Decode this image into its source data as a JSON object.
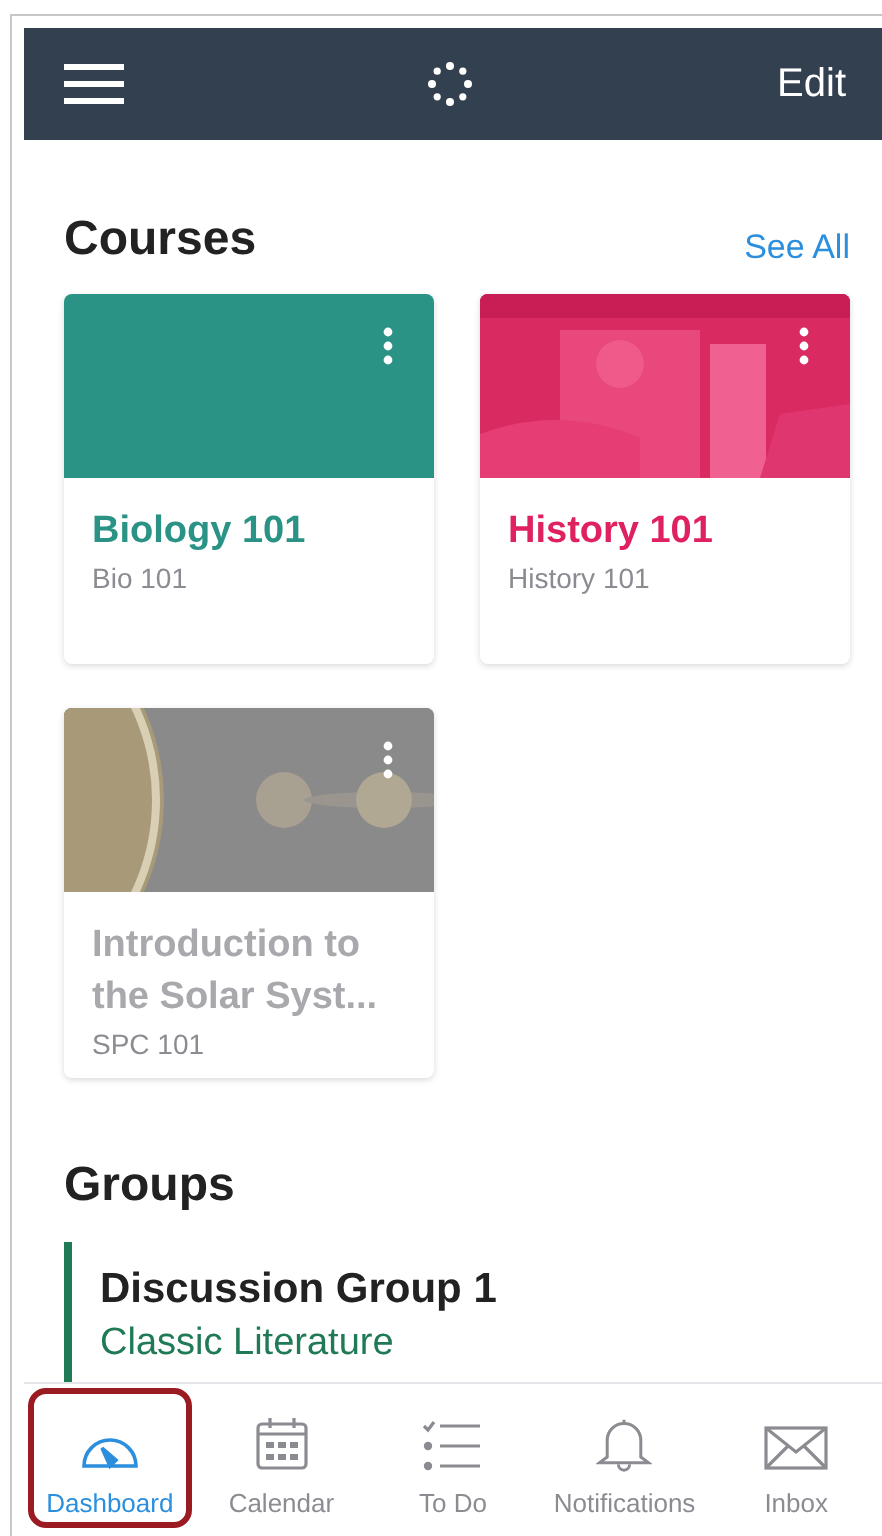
{
  "header": {
    "edit": "Edit"
  },
  "courses": {
    "title": "Courses",
    "see_all": "See All",
    "items": [
      {
        "name": "Biology 101",
        "code": "Bio 101",
        "color": "#2a9385",
        "kind": "color",
        "faded": false
      },
      {
        "name": "History 101",
        "code": "History 101",
        "color": "#e0215f",
        "kind": "picture",
        "faded": false
      },
      {
        "name": "Introduction to the Solar Syst...",
        "code": "SPC 101",
        "color": "#8a8a8a",
        "kind": "picture",
        "faded": true
      }
    ]
  },
  "groups": {
    "title": "Groups",
    "items": [
      {
        "name": "Discussion Group 1",
        "course": "Classic Literature",
        "color": "#1f7a55"
      }
    ]
  },
  "tabs": [
    {
      "label": "Dashboard",
      "kind": "gauge",
      "selected": true,
      "highlighted": true
    },
    {
      "label": "Calendar",
      "kind": "calendar",
      "selected": false,
      "highlighted": false
    },
    {
      "label": "To Do",
      "kind": "todo",
      "selected": false,
      "highlighted": false
    },
    {
      "label": "Notifications",
      "kind": "bell",
      "selected": false,
      "highlighted": false
    },
    {
      "label": "Inbox",
      "kind": "mail",
      "selected": false,
      "highlighted": false
    }
  ]
}
